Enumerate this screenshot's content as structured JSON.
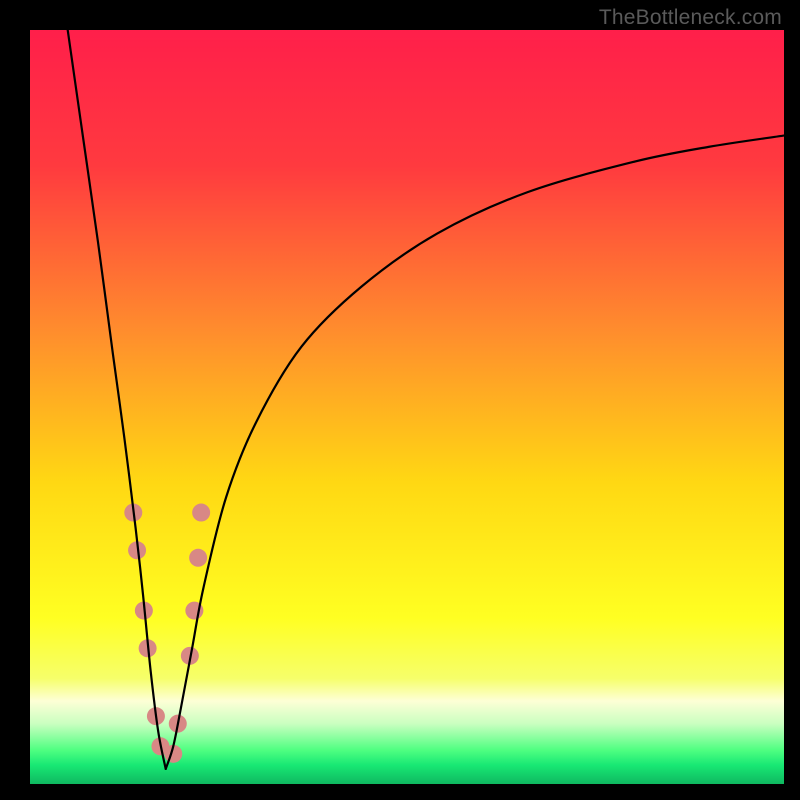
{
  "watermark": "TheBottleneck.com",
  "gradient_stops": [
    {
      "offset": 0.0,
      "color": "#ff1f4a"
    },
    {
      "offset": 0.18,
      "color": "#ff3a3f"
    },
    {
      "offset": 0.4,
      "color": "#ff8d2d"
    },
    {
      "offset": 0.6,
      "color": "#ffd813"
    },
    {
      "offset": 0.78,
      "color": "#ffff22"
    },
    {
      "offset": 0.86,
      "color": "#f6ff6a"
    },
    {
      "offset": 0.89,
      "color": "#fdffd6"
    },
    {
      "offset": 0.92,
      "color": "#caffc0"
    },
    {
      "offset": 0.955,
      "color": "#4fff81"
    },
    {
      "offset": 0.975,
      "color": "#18e874"
    },
    {
      "offset": 1.0,
      "color": "#0fb860"
    }
  ],
  "chart_data": {
    "type": "line",
    "title": "",
    "xlabel": "",
    "ylabel": "",
    "xlim": [
      0,
      100
    ],
    "ylim": [
      0,
      100
    ],
    "note": "V-shaped performance-bottleneck curve. Background gradient encodes bottleneck severity (red=high, green=low). Two black curves descend to a narrow valley near x≈18 where y≈2. Pink dot markers cluster near the valley walls. The right curve rises asymptotically toward y≈86 at x=100.",
    "series": [
      {
        "name": "left-branch",
        "x": [
          5.0,
          7.0,
          9.0,
          11.0,
          12.5,
          14.0,
          15.0,
          16.0,
          17.0,
          18.0
        ],
        "y": [
          100.0,
          86.0,
          72.0,
          57.0,
          46.0,
          34.0,
          25.0,
          15.0,
          7.0,
          2.0
        ]
      },
      {
        "name": "right-branch",
        "x": [
          18.0,
          19.0,
          20.0,
          21.5,
          23.0,
          26.0,
          30.0,
          36.0,
          44.0,
          54.0,
          66.0,
          80.0,
          90.0,
          100.0
        ],
        "y": [
          2.0,
          5.0,
          10.0,
          18.0,
          26.0,
          38.0,
          48.0,
          58.0,
          66.0,
          73.0,
          78.5,
          82.5,
          84.5,
          86.0
        ]
      }
    ],
    "markers": [
      {
        "x": 13.7,
        "y": 36.0
      },
      {
        "x": 14.2,
        "y": 31.0
      },
      {
        "x": 15.1,
        "y": 23.0
      },
      {
        "x": 15.6,
        "y": 18.0
      },
      {
        "x": 16.7,
        "y": 9.0
      },
      {
        "x": 17.3,
        "y": 5.0
      },
      {
        "x": 19.0,
        "y": 4.0
      },
      {
        "x": 19.6,
        "y": 8.0
      },
      {
        "x": 21.2,
        "y": 17.0
      },
      {
        "x": 21.8,
        "y": 23.0
      },
      {
        "x": 22.3,
        "y": 30.0
      },
      {
        "x": 22.7,
        "y": 36.0
      }
    ],
    "marker_style": {
      "color": "#d88885",
      "radius_px": 9
    }
  }
}
